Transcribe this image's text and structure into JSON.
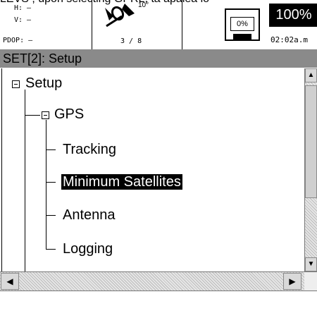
{
  "top_caption": "LEVS , upon selecting GPRL, ta apalea io",
  "status": {
    "h_label": "H: –",
    "v_label": "V: –",
    "pdop_label": "PDOP: –",
    "sat_degree": "10°",
    "sat_count": "3 / 8",
    "storage_percent": "0%",
    "battery_percent": "100%",
    "clock": "02:02a.m"
  },
  "title_bar": "SET[2]: Setup",
  "tree": {
    "root": "Setup",
    "gps": "GPS",
    "children": [
      "Tracking",
      "Minimum Satellites",
      "Antenna",
      "Logging"
    ],
    "selected": "Minimum Satellites"
  },
  "icons": {
    "satellite": "satellite-icon",
    "storage": "floppy-disk-icon",
    "battery": "battery-icon",
    "scroll_up": "arrow-up-icon",
    "scroll_down": "arrow-down-icon",
    "scroll_left": "arrow-left-icon",
    "scroll_right": "arrow-right-icon",
    "expander": "tree-minus-icon"
  },
  "colors": {
    "title_bar_bg": "#8a8a8a",
    "selection_bg": "#000000",
    "selection_fg": "#ffffff"
  }
}
